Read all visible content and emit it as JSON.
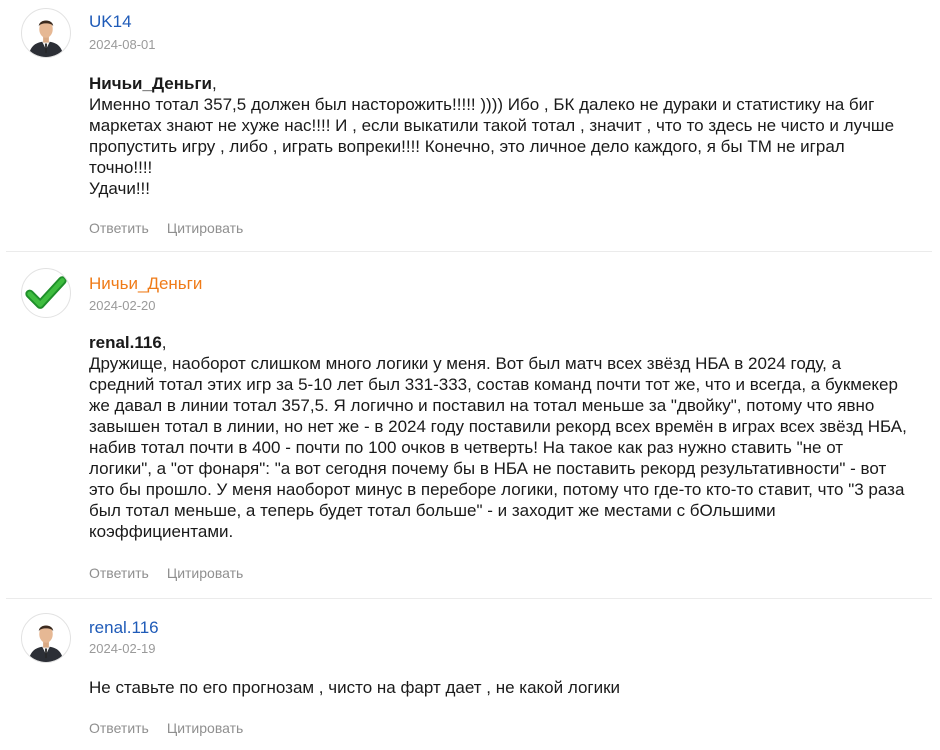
{
  "actions": {
    "reply_label": "Ответить",
    "quote_label": "Цитировать"
  },
  "comments": [
    {
      "author": "UK14",
      "date": "2024-08-01",
      "reply_to": "Ничьи_Деньги",
      "text": "Именно тотал 357,5 должен был насторожить!!!!! )))) Ибо , БК далеко не дураки и статистику на биг маркетах знают не хуже нас!!!! И , если выкатили такой тотал , значит , что то здесь не чисто и лучше пропустить игру , либо , играть вопреки!!!! Конечно, это личное дело каждого, я бы ТМ не играл точно!!!!\nУдачи!!!"
    },
    {
      "author": "Ничьи_Деньги",
      "date": "2024-02-20",
      "reply_to": "renal.116",
      "text": "Дружище, наоборот слишком много логики у меня. Вот был матч всех звёзд НБА в 2024 году, а средний тотал этих игр за 5-10 лет был 331-333, состав команд почти тот же, что и всегда, а букмекер же давал в линии тотал 357,5. Я логично и поставил на тотал меньше за \"двойку\", потому что явно завышен тотал в линии, но нет же - в 2024 году поставили рекорд всех времён в играх всех звёзд НБА, набив тотал почти в 400 - почти по 100 очков в четверть! На такое как раз нужно ставить \"не от логики\", а \"от фонаря\": \"а вот сегодня почему бы в НБА не поставить рекорд результативности\" - вот это бы прошло. У меня наоборот минус в переборе логики, потому что где-то кто-то ставит, что \"3 раза был тотал меньше, а теперь будет тотал больше\" - и заходит же местами с бОльшими коэффициентами."
    },
    {
      "author": "renal.116",
      "date": "2024-02-19",
      "reply_to": "",
      "text": "Не ставьте по его прогнозам , чисто на фарт дает , не какой логики"
    }
  ]
}
